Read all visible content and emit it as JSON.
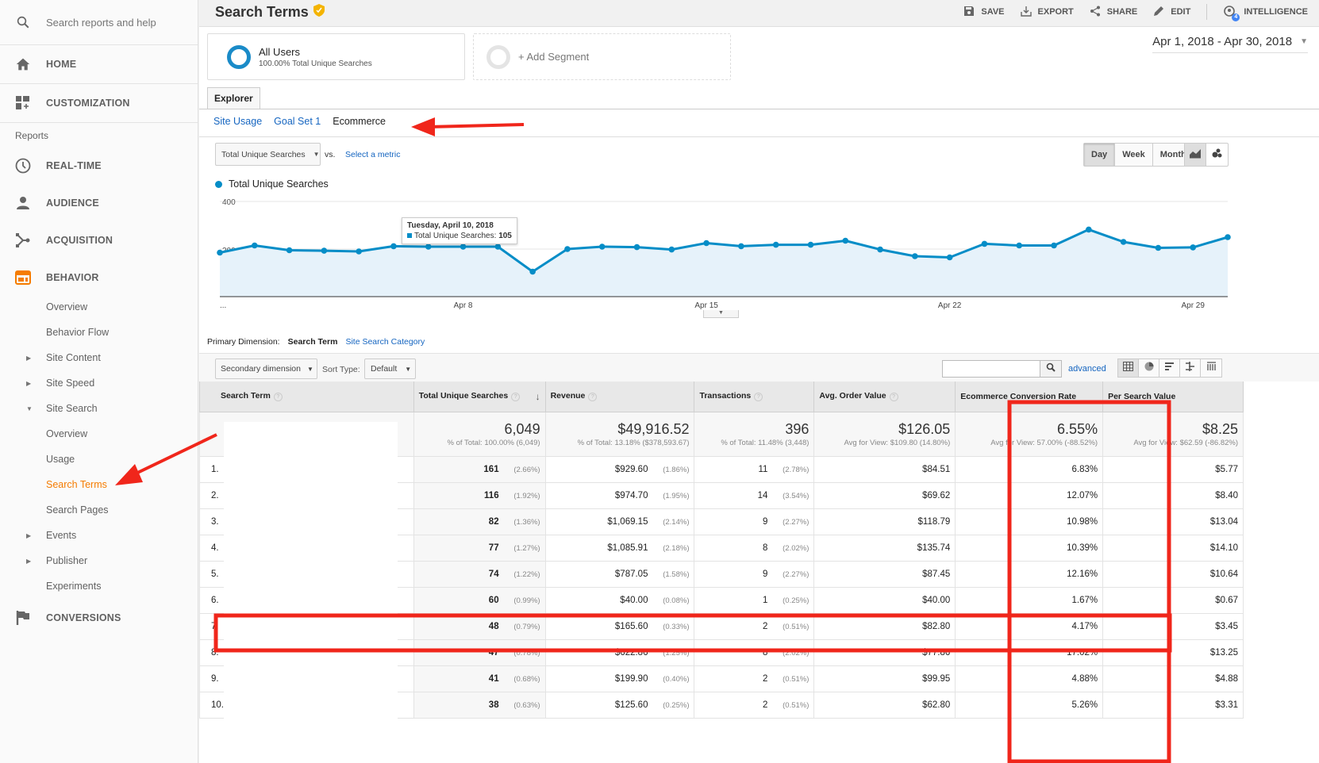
{
  "sidebar": {
    "search_placeholder": "Search reports and help",
    "home": "HOME",
    "customization": "CUSTOMIZATION",
    "reports_label": "Reports",
    "sections": [
      {
        "label": "REAL-TIME",
        "icon": "clock-icon"
      },
      {
        "label": "AUDIENCE",
        "icon": "person-icon"
      },
      {
        "label": "ACQUISITION",
        "icon": "acquisition-icon"
      },
      {
        "label": "BEHAVIOR",
        "icon": "behavior-icon"
      }
    ],
    "behavior_items": [
      {
        "label": "Overview",
        "caret": ""
      },
      {
        "label": "Behavior Flow",
        "caret": ""
      },
      {
        "label": "Site Content",
        "caret": "▶"
      },
      {
        "label": "Site Speed",
        "caret": "▶"
      },
      {
        "label": "Site Search",
        "caret": "▼"
      },
      {
        "label": "Overview",
        "caret": ""
      },
      {
        "label": "Usage",
        "caret": ""
      },
      {
        "label": "Search Terms",
        "caret": "",
        "active": true
      },
      {
        "label": "Search Pages",
        "caret": ""
      },
      {
        "label": "Events",
        "caret": "▶"
      },
      {
        "label": "Publisher",
        "caret": "▶"
      },
      {
        "label": "Experiments",
        "caret": ""
      }
    ],
    "conversions": "CONVERSIONS",
    "accent_color": "#f57c00"
  },
  "header": {
    "title": "Search Terms",
    "toolbar": {
      "save": "SAVE",
      "export": "EXPORT",
      "share": "SHARE",
      "edit": "EDIT",
      "intelligence": "INTELLIGENCE",
      "intelligence_badge": "4"
    }
  },
  "segments": {
    "all_users_title": "All Users",
    "all_users_sub": "100.00% Total Unique Searches",
    "add_segment": "+ Add Segment"
  },
  "date_range": "Apr 1, 2018 - Apr 30, 2018",
  "tabs": {
    "explorer": "Explorer",
    "subtabs": [
      "Site Usage",
      "Goal Set 1",
      "Ecommerce"
    ],
    "current_subtab": "Ecommerce"
  },
  "chart_controls": {
    "metric": "Total Unique Searches",
    "vs": "vs.",
    "select_metric": "Select a metric",
    "periods": [
      "Day",
      "Week",
      "Month"
    ],
    "selected_period": "Day"
  },
  "chart_data": {
    "type": "area",
    "series": [
      {
        "name": "Total Unique Searches",
        "color": "#058dc7",
        "values": [
          185,
          215,
          195,
          193,
          190,
          212,
          210,
          210,
          210,
          105,
          200,
          210,
          208,
          198,
          225,
          212,
          218,
          218,
          235,
          198,
          170,
          165,
          222,
          215,
          215,
          282,
          230,
          205,
          207,
          250
        ]
      }
    ],
    "x": [
      "Apr 1",
      "Apr 2",
      "Apr 3",
      "Apr 4",
      "Apr 5",
      "Apr 6",
      "Apr 7",
      "Apr 8",
      "Apr 9",
      "Apr 10",
      "Apr 11",
      "Apr 12",
      "Apr 13",
      "Apr 14",
      "Apr 15",
      "Apr 16",
      "Apr 17",
      "Apr 18",
      "Apr 19",
      "Apr 20",
      "Apr 21",
      "Apr 22",
      "Apr 23",
      "Apr 24",
      "Apr 25",
      "Apr 26",
      "Apr 27",
      "Apr 28",
      "Apr 29",
      "Apr 30"
    ],
    "x_tick_labels": [
      "...",
      "Apr 8",
      "Apr 15",
      "Apr 22",
      "Apr 29"
    ],
    "y_tick_labels": [
      "400",
      "200"
    ],
    "ylim": [
      0,
      400
    ],
    "legend": "top-left",
    "grid": true,
    "tooltip": {
      "title": "Tuesday, April 10, 2018",
      "label": "Total Unique Searches:",
      "value": "105"
    }
  },
  "table_controls": {
    "primary_dimension_label": "Primary Dimension:",
    "primary_dimension": "Search Term",
    "alt_dimension": "Site Search Category",
    "secondary_dimension": "Secondary dimension",
    "sort_type_label": "Sort Type:",
    "sort_type": "Default",
    "search_value": "",
    "advanced": "advanced"
  },
  "table": {
    "columns": [
      "Search Term",
      "Total Unique Searches",
      "Revenue",
      "Transactions",
      "Avg. Order Value",
      "Ecommerce Conversion Rate",
      "Per Search Value"
    ],
    "totals": {
      "searches": "6,049",
      "searches_sub": "% of Total: 100.00% (6,049)",
      "revenue": "$49,916.52",
      "revenue_sub": "% of Total: 13.18% ($378,593.67)",
      "transactions": "396",
      "transactions_sub": "% of Total: 11.48% (3,448)",
      "aov": "$126.05",
      "aov_sub": "Avg for View: $109.80 (14.80%)",
      "conv": "6.55%",
      "conv_sub": "Avg for View: 57.00% (-88.52%)",
      "psv": "$8.25",
      "psv_sub": "Avg for View: $62.59 (-86.82%)"
    },
    "rows": [
      {
        "idx": "1.",
        "searches": "161",
        "searches_pct": "(2.66%)",
        "revenue": "$929.60",
        "revenue_pct": "(1.86%)",
        "trans": "11",
        "trans_pct": "(2.78%)",
        "aov": "$84.51",
        "conv": "6.83%",
        "psv": "$5.77"
      },
      {
        "idx": "2.",
        "searches": "116",
        "searches_pct": "(1.92%)",
        "revenue": "$974.70",
        "revenue_pct": "(1.95%)",
        "trans": "14",
        "trans_pct": "(3.54%)",
        "aov": "$69.62",
        "conv": "12.07%",
        "psv": "$8.40"
      },
      {
        "idx": "3.",
        "searches": "82",
        "searches_pct": "(1.36%)",
        "revenue": "$1,069.15",
        "revenue_pct": "(2.14%)",
        "trans": "9",
        "trans_pct": "(2.27%)",
        "aov": "$118.79",
        "conv": "10.98%",
        "psv": "$13.04"
      },
      {
        "idx": "4.",
        "searches": "77",
        "searches_pct": "(1.27%)",
        "revenue": "$1,085.91",
        "revenue_pct": "(2.18%)",
        "trans": "8",
        "trans_pct": "(2.02%)",
        "aov": "$135.74",
        "conv": "10.39%",
        "psv": "$14.10"
      },
      {
        "idx": "5.",
        "searches": "74",
        "searches_pct": "(1.22%)",
        "revenue": "$787.05",
        "revenue_pct": "(1.58%)",
        "trans": "9",
        "trans_pct": "(2.27%)",
        "aov": "$87.45",
        "conv": "12.16%",
        "psv": "$10.64"
      },
      {
        "idx": "6.",
        "searches": "60",
        "searches_pct": "(0.99%)",
        "revenue": "$40.00",
        "revenue_pct": "(0.08%)",
        "trans": "1",
        "trans_pct": "(0.25%)",
        "aov": "$40.00",
        "conv": "1.67%",
        "psv": "$0.67"
      },
      {
        "idx": "7.",
        "searches": "48",
        "searches_pct": "(0.79%)",
        "revenue": "$165.60",
        "revenue_pct": "(0.33%)",
        "trans": "2",
        "trans_pct": "(0.51%)",
        "aov": "$82.80",
        "conv": "4.17%",
        "psv": "$3.45"
      },
      {
        "idx": "8.",
        "searches": "47",
        "searches_pct": "(0.78%)",
        "revenue": "$622.86",
        "revenue_pct": "(1.25%)",
        "trans": "8",
        "trans_pct": "(2.02%)",
        "aov": "$77.86",
        "conv": "17.02%",
        "psv": "$13.25"
      },
      {
        "idx": "9.",
        "searches": "41",
        "searches_pct": "(0.68%)",
        "revenue": "$199.90",
        "revenue_pct": "(0.40%)",
        "trans": "2",
        "trans_pct": "(0.51%)",
        "aov": "$99.95",
        "conv": "4.88%",
        "psv": "$4.88"
      },
      {
        "idx": "10.",
        "searches": "38",
        "searches_pct": "(0.63%)",
        "revenue": "$125.60",
        "revenue_pct": "(0.25%)",
        "trans": "2",
        "trans_pct": "(0.51%)",
        "aov": "$62.80",
        "conv": "5.26%",
        "psv": "$3.31"
      }
    ]
  },
  "annotation_color": "#f0261b"
}
